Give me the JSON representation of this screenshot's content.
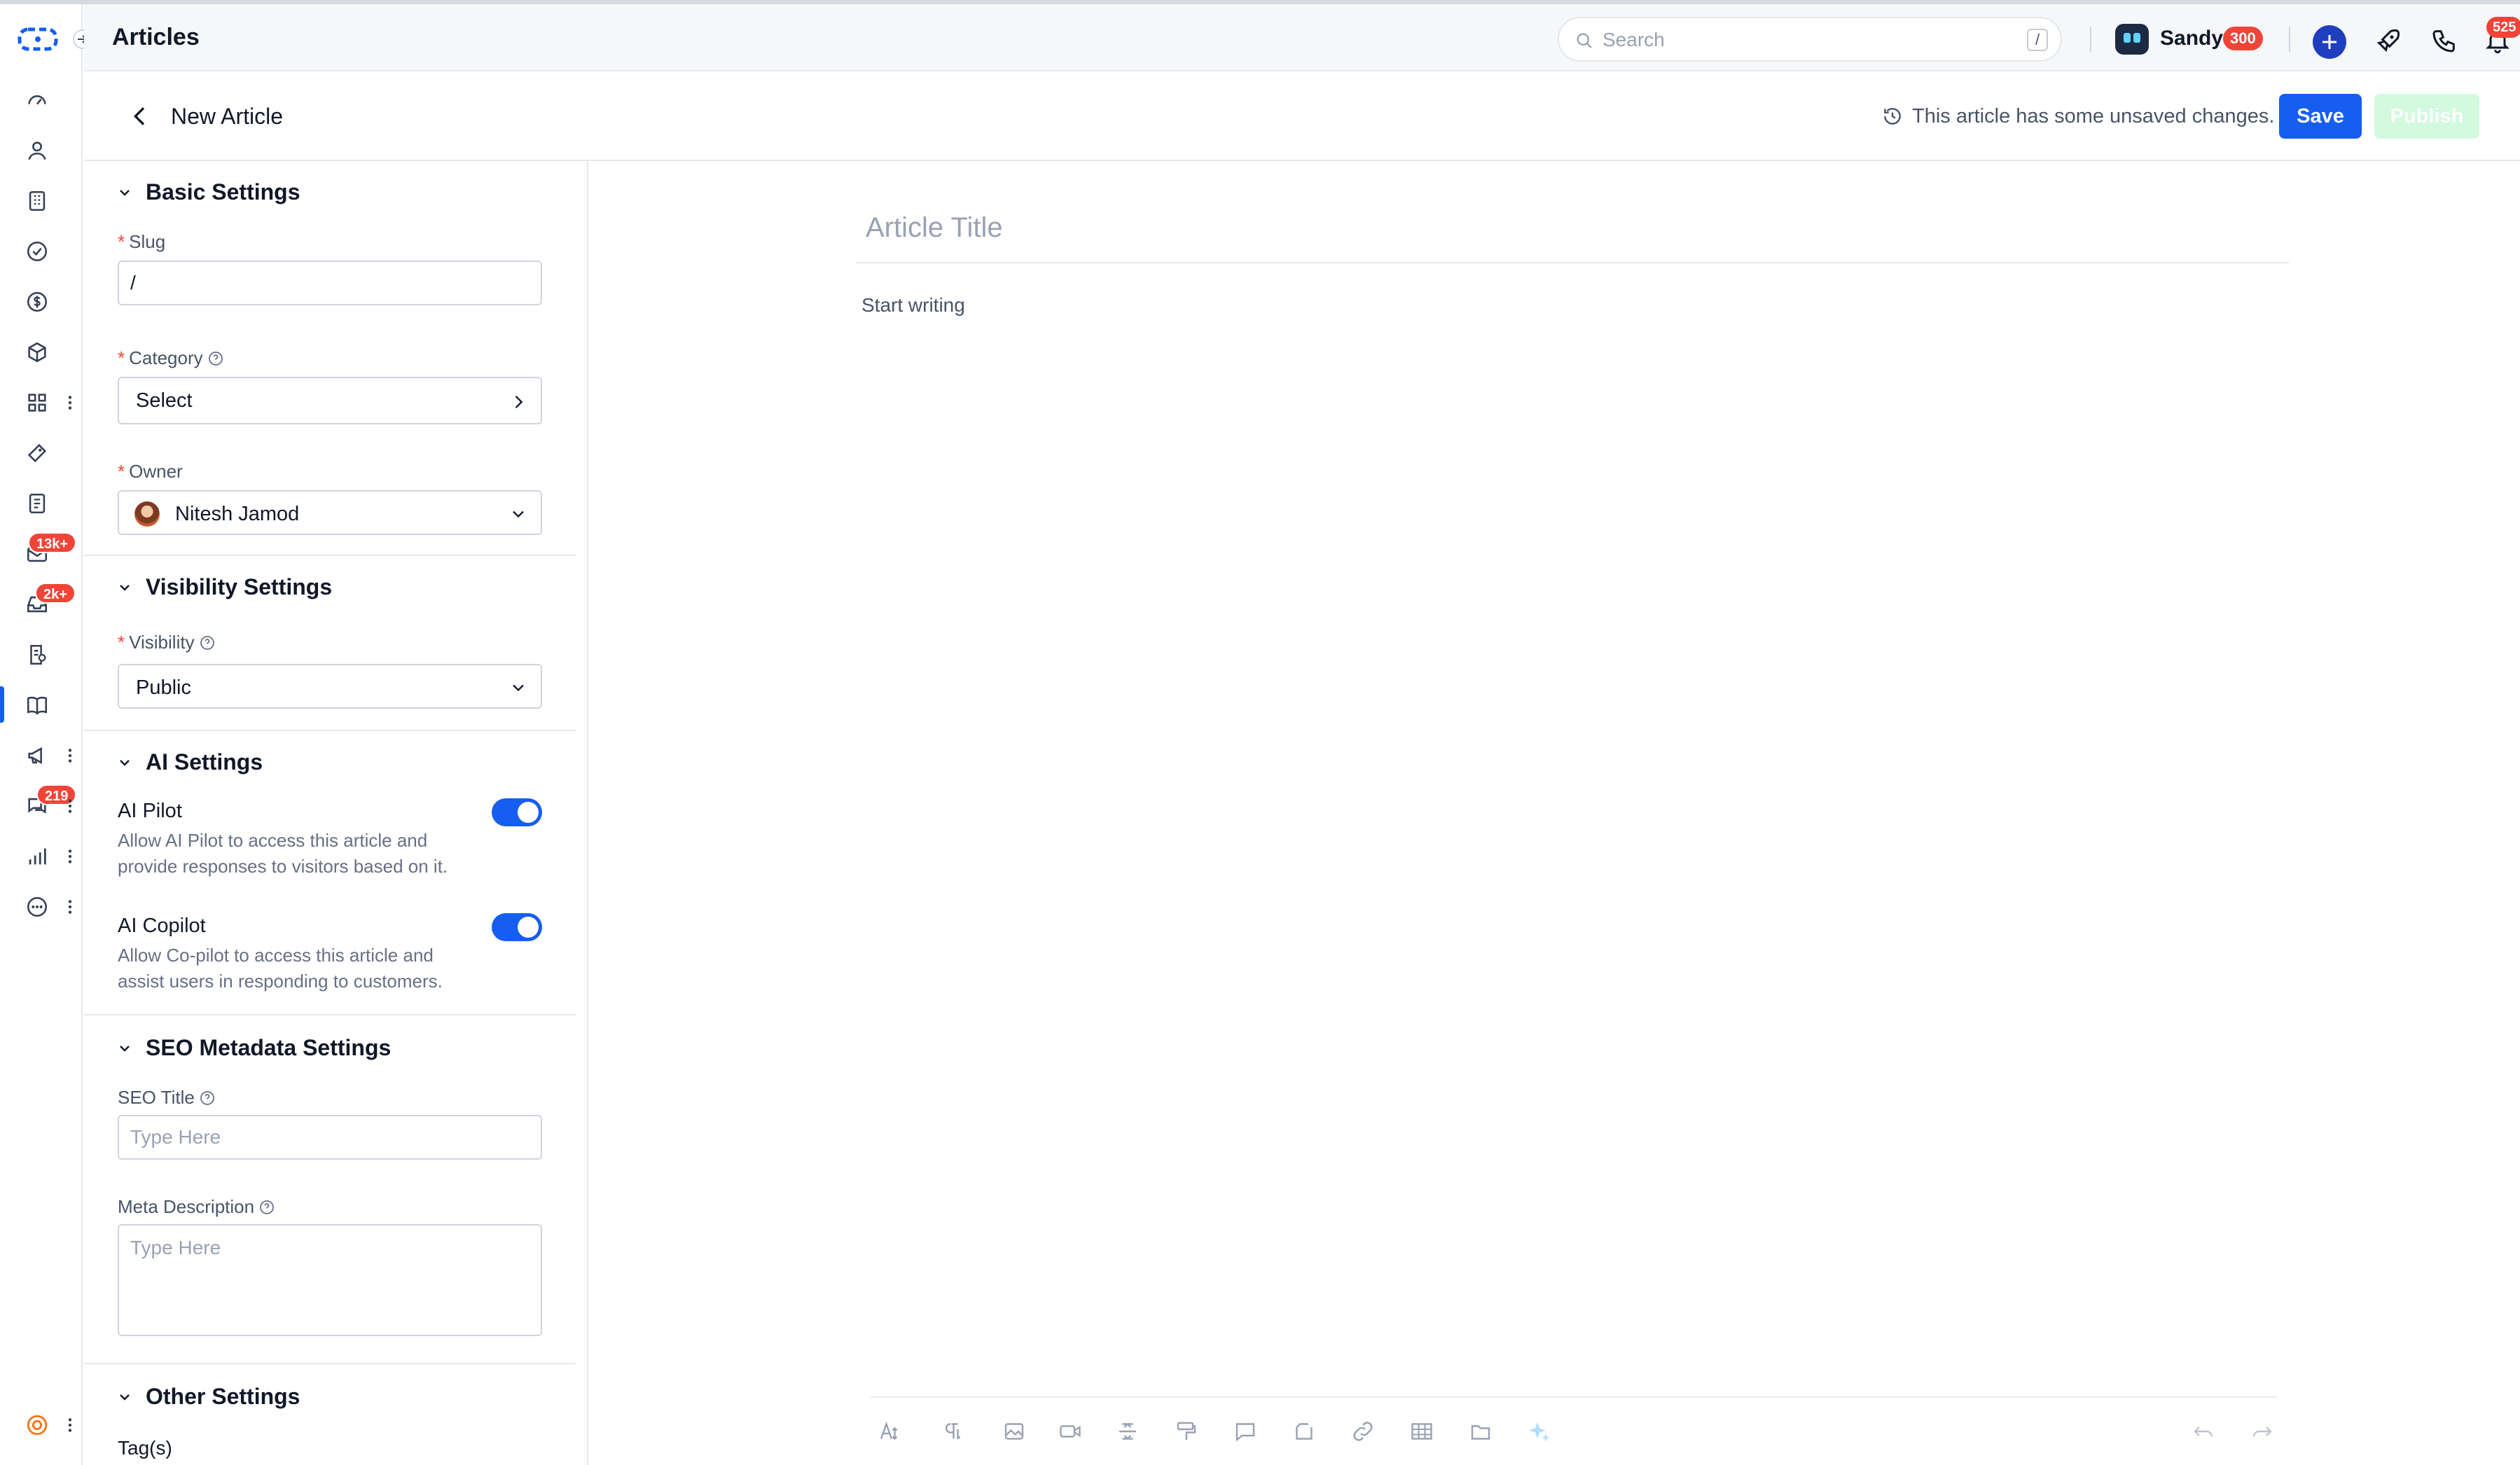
{
  "header": {
    "title": "Articles",
    "search_placeholder": "Search",
    "search_shortcut": "/",
    "user_name": "Sandy",
    "credit_count": "300",
    "notification_count": "525"
  },
  "rail_badges": {
    "email": "13k+",
    "inbox": "2k+",
    "chat": "219"
  },
  "subheader": {
    "heading": "New Article",
    "unsaved_text": "This article has some unsaved changes.",
    "save_label": "Save",
    "publish_label": "Publish"
  },
  "settings": {
    "basic": {
      "title": "Basic Settings",
      "slug_label": "Slug",
      "slug_value": "/",
      "category_label": "Category",
      "category_value": "Select",
      "owner_label": "Owner",
      "owner_value": "Nitesh Jamod"
    },
    "visibility": {
      "title": "Visibility Settings",
      "visibility_label": "Visibility",
      "visibility_value": "Public"
    },
    "ai": {
      "title": "AI Settings",
      "pilot_title": "AI Pilot",
      "pilot_desc": "Allow AI Pilot to access this article and provide responses to visitors based on it.",
      "pilot_enabled": true,
      "copilot_title": "AI Copilot",
      "copilot_desc": "Allow Co-pilot to access this article and assist users in responding to customers.",
      "copilot_enabled": true
    },
    "seo": {
      "title": "SEO Metadata Settings",
      "seo_title_label": "SEO Title",
      "seo_title_placeholder": "Type Here",
      "meta_label": "Meta Description",
      "meta_placeholder": "Type Here"
    },
    "other": {
      "title": "Other Settings",
      "tags_label": "Tag(s)"
    }
  },
  "editor": {
    "title_placeholder": "Article Title",
    "body_placeholder": "Start writing"
  },
  "colors": {
    "primary": "#155eef",
    "badge": "#f04438",
    "publish_disabled": "#d1fadf"
  }
}
